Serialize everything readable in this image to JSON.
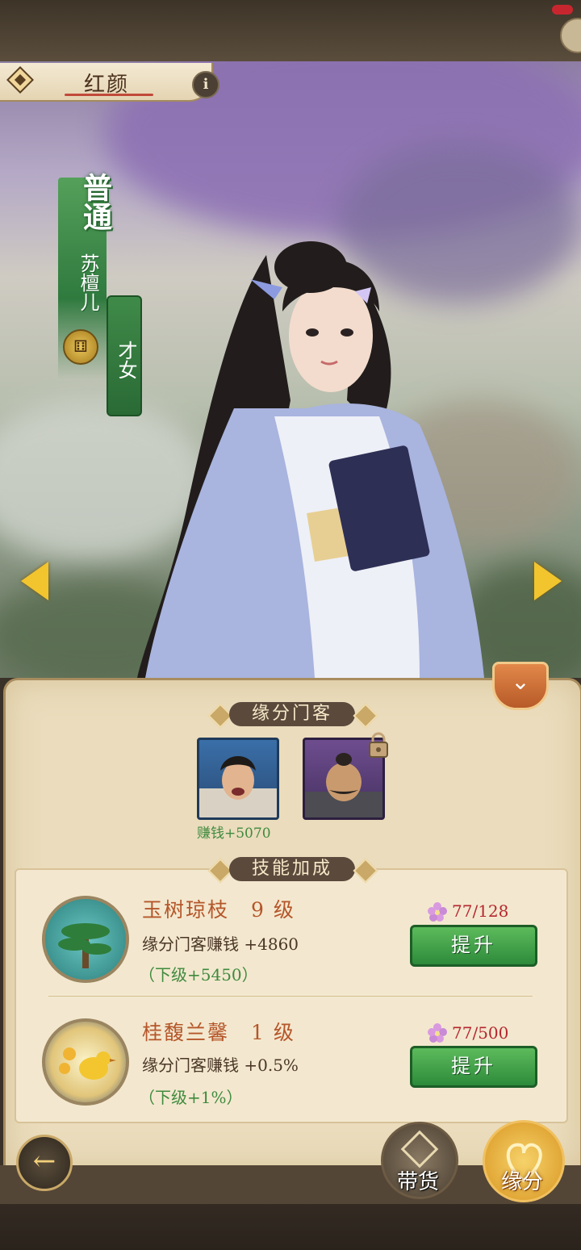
{
  "header": {
    "title": "红颜",
    "info_label": "i"
  },
  "character": {
    "rank": "普通",
    "name": "苏檀儿",
    "trait": "才女"
  },
  "fate_section": {
    "title": "缘分门客",
    "retainers": [
      {
        "label": "赚钱+5070",
        "locked": false
      },
      {
        "label": "",
        "locked": true
      }
    ]
  },
  "skill_section": {
    "title": "技能加成",
    "skills": [
      {
        "name": "玉树琼枝",
        "level": "9 级",
        "effect": "缘分门客赚钱 +4860",
        "next": "（下级+5450）",
        "cost": "77/128",
        "button": "提升",
        "icon": "pine-tree-icon"
      },
      {
        "name": "桂馥兰馨",
        "level": "1 级",
        "effect": "缘分门客赚钱 +0.5%",
        "next": "（下级+1%）",
        "cost": "77/500",
        "button": "提升",
        "icon": "bird-flower-icon"
      }
    ]
  },
  "bottom_tabs": [
    {
      "label": "带货",
      "icon": "goods-icon"
    },
    {
      "label": "缘分",
      "icon": "fate-icon",
      "active": true
    }
  ],
  "colors": {
    "accent_green": "#2d8a3a",
    "skill_name": "#b5562a",
    "cost_red": "#b5262e",
    "panel": "#eadcbc"
  }
}
